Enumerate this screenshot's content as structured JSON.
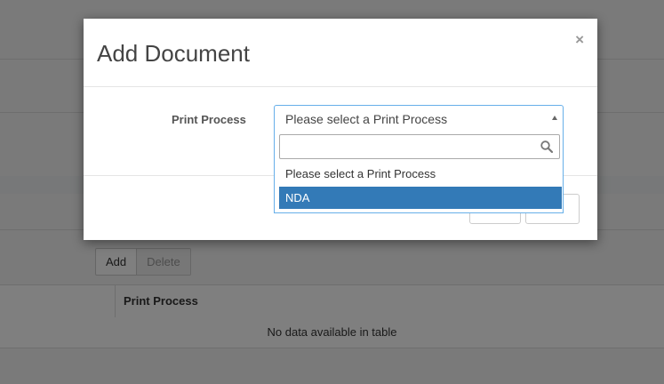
{
  "background": {
    "toolbar": {
      "add_label": "Add",
      "delete_label": "Delete"
    },
    "table": {
      "columns": [
        "Print Process"
      ],
      "empty_message": "No data available in table"
    }
  },
  "modal": {
    "title": "Add Document",
    "close_glyph": "×",
    "field_label": "Print Process",
    "select": {
      "selected_value": "Please select a Print Process",
      "search_value": "",
      "options": [
        {
          "label": "Please select a Print Process",
          "highlighted": false
        },
        {
          "label": "NDA",
          "highlighted": true
        }
      ]
    }
  },
  "colors": {
    "highlight": "#337ab7",
    "focus_border": "#66afe9"
  }
}
